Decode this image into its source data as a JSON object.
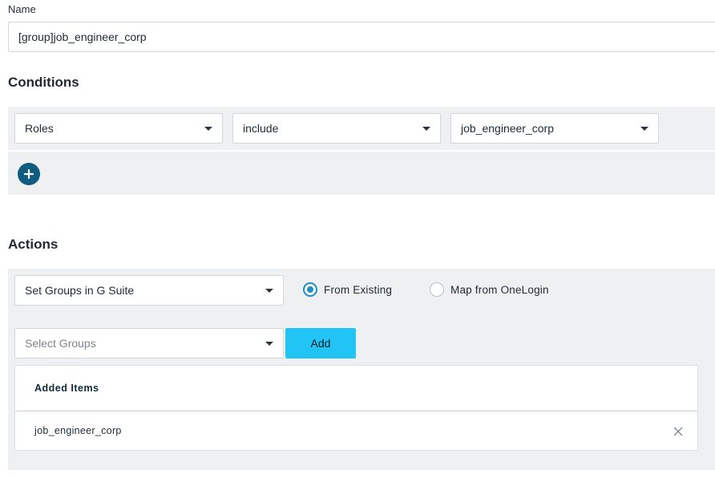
{
  "name_field": {
    "label": "Name",
    "value": "[group]job_engineer_corp"
  },
  "conditions": {
    "title": "Conditions",
    "row": {
      "field": "Roles",
      "operator": "include",
      "value": "job_engineer_corp"
    },
    "add_icon": "plus-icon"
  },
  "actions": {
    "title": "Actions",
    "action_select": "Set Groups in G Suite",
    "radio_options": [
      {
        "label": "From Existing",
        "checked": true
      },
      {
        "label": "Map from OneLogin",
        "checked": false
      }
    ],
    "groups_select_placeholder": "Select Groups",
    "add_label": "Add",
    "added_items_header": "Added Items",
    "added_items": [
      "job_engineer_corp"
    ]
  },
  "colors": {
    "accent_blue": "#0f5c80",
    "add_button": "#21c4f5",
    "radio_selected": "#1a8fc7",
    "panel_bg": "#eff0f2"
  }
}
